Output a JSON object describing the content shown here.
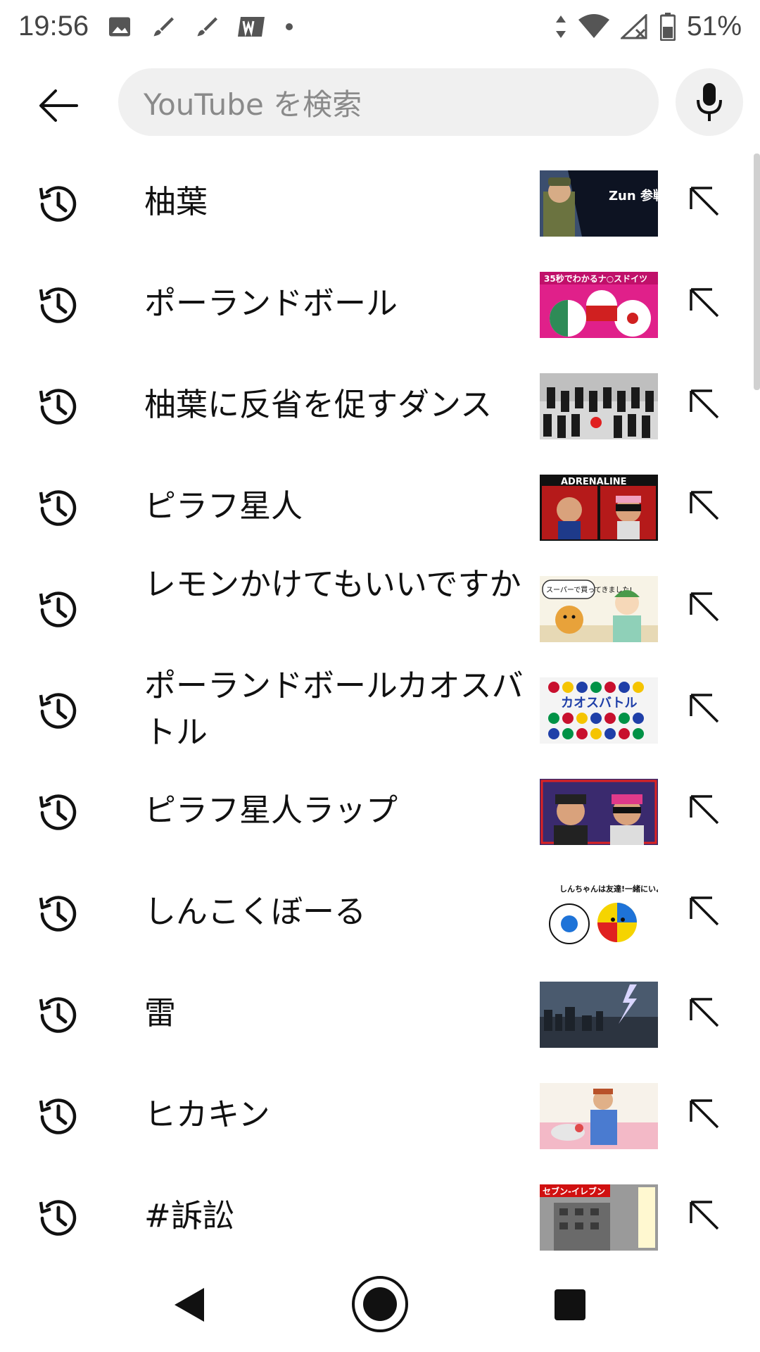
{
  "status_bar": {
    "time": "19:56",
    "battery": "51%",
    "icons": [
      "image-icon",
      "brush-icon",
      "brush-icon",
      "app-logo-icon",
      "dot-icon",
      "data-arrows-icon",
      "wifi-icon",
      "signal-off-icon",
      "battery-icon"
    ]
  },
  "search": {
    "placeholder": "YouTube を検索",
    "back_icon": "arrow-left-icon",
    "mic_icon": "microphone-icon"
  },
  "history": [
    {
      "text": "柚葉",
      "thumb": {
        "desc_color": "#3b4e6e",
        "accent": "#f2c12e"
      }
    },
    {
      "text": "ポーランドボール",
      "thumb": {
        "desc_color": "#e0208a",
        "accent": "#2e8b57"
      }
    },
    {
      "text": "柚葉に反省を促すダンス",
      "thumb": {
        "desc_color": "#d8d8d8",
        "accent": "#1a1a1a"
      }
    },
    {
      "text": "ピラフ星人",
      "thumb": {
        "desc_color": "#b51a1a",
        "accent": "#111111"
      }
    },
    {
      "text": "レモンかけてもいいですか",
      "thumb": {
        "desc_color": "#f7f3e6",
        "accent": "#e8a23a"
      }
    },
    {
      "text": "ポーランドボールカオスバトル",
      "thumb": {
        "desc_color": "#f4f4f4",
        "accent": "#1f3fa8"
      }
    },
    {
      "text": "ピラフ星人ラップ",
      "thumb": {
        "desc_color": "#3a2a6e",
        "accent": "#e03a8a"
      }
    },
    {
      "text": "しんこくぼーる",
      "thumb": {
        "desc_color": "#ffffff",
        "accent": "#f5d400"
      }
    },
    {
      "text": "雷",
      "thumb": {
        "desc_color": "#4a5a6e",
        "accent": "#d9d6ff"
      }
    },
    {
      "text": "ヒカキン",
      "thumb": {
        "desc_color": "#f3b9c7",
        "accent": "#4a7bd0"
      }
    },
    {
      "text": "#訴訟",
      "thumb": {
        "desc_color": "#9a9a9a",
        "accent": "#d01010"
      }
    }
  ],
  "thumb_captions": {
    "item0": "Zun 参戦!",
    "item1": "35秒でわかるナ○スドイツ",
    "item3": "ADRENALINE",
    "item4": "スーパーで買ってきました!",
    "item5": "カオスバトル",
    "item7": "しんちゃんは友達!一緒にいようね!",
    "item10": "セブン-イレブン"
  },
  "nav": {
    "back_icon": "nav-back-icon",
    "home_icon": "nav-home-icon",
    "recents_icon": "nav-recents-icon"
  }
}
